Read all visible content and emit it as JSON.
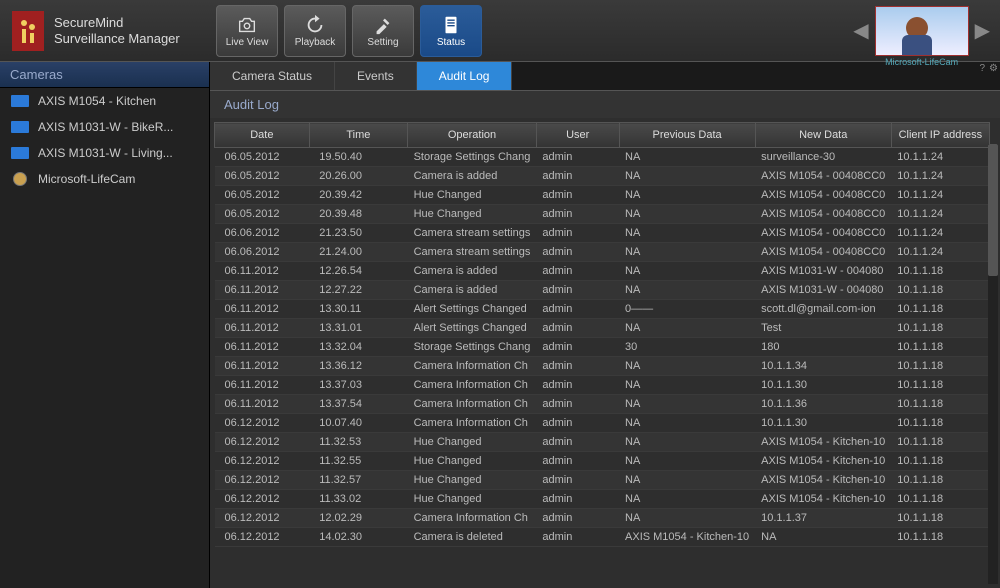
{
  "app": {
    "name": "SecureMind",
    "subtitle": "Surveillance Manager"
  },
  "toolbar": [
    {
      "id": "live-view",
      "label": "Live View",
      "icon": "camera",
      "active": false
    },
    {
      "id": "playback",
      "label": "Playback",
      "icon": "refresh",
      "active": false
    },
    {
      "id": "setting",
      "label": "Setting",
      "icon": "tools",
      "active": false
    },
    {
      "id": "status",
      "label": "Status",
      "icon": "document",
      "active": true
    }
  ],
  "preview": {
    "label": "Microsoft-LifeCam"
  },
  "sidebar": {
    "header": "Cameras",
    "items": [
      {
        "label": "AXIS M1054 - Kitchen",
        "icon": "cam"
      },
      {
        "label": "AXIS M1031-W - BikeR...",
        "icon": "cam"
      },
      {
        "label": "AXIS M1031-W - Living...",
        "icon": "cam"
      },
      {
        "label": "Microsoft-LifeCam",
        "icon": "webcam"
      }
    ]
  },
  "tabs": [
    {
      "label": "Camera Status",
      "active": false
    },
    {
      "label": "Events",
      "active": false
    },
    {
      "label": "Audit Log",
      "active": true
    }
  ],
  "section_title": "Audit Log",
  "columns": [
    "Date",
    "Time",
    "Operation",
    "User",
    "Previous Data",
    "New Data",
    "Client IP address"
  ],
  "rows": [
    [
      "06.05.2012",
      "19.50.40",
      "Storage Settings Chang",
      "admin",
      "NA",
      "surveillance-30",
      "10.1.1.24"
    ],
    [
      "06.05.2012",
      "20.26.00",
      "Camera is added",
      "admin",
      "NA",
      "AXIS M1054 - 00408CC0",
      "10.1.1.24"
    ],
    [
      "06.05.2012",
      "20.39.42",
      "Hue Changed",
      "admin",
      "NA",
      "AXIS M1054 - 00408CC0",
      "10.1.1.24"
    ],
    [
      "06.05.2012",
      "20.39.48",
      "Hue Changed",
      "admin",
      "NA",
      "AXIS M1054 - 00408CC0",
      "10.1.1.24"
    ],
    [
      "06.06.2012",
      "21.23.50",
      "Camera stream settings",
      "admin",
      "NA",
      "AXIS M1054 - 00408CC0",
      "10.1.1.24"
    ],
    [
      "06.06.2012",
      "21.24.00",
      "Camera stream settings",
      "admin",
      "NA",
      "AXIS M1054 - 00408CC0",
      "10.1.1.24"
    ],
    [
      "06.11.2012",
      "12.26.54",
      "Camera is added",
      "admin",
      "NA",
      "AXIS M1031-W - 004080",
      "10.1.1.18"
    ],
    [
      "06.11.2012",
      "12.27.22",
      "Camera is added",
      "admin",
      "NA",
      "AXIS M1031-W - 004080",
      "10.1.1.18"
    ],
    [
      "06.11.2012",
      "13.30.11",
      "Alert Settings Changed",
      "admin",
      "0——",
      "scott.dl@gmail.com-ion",
      "10.1.1.18"
    ],
    [
      "06.11.2012",
      "13.31.01",
      "Alert Settings Changed",
      "admin",
      "NA",
      "Test",
      "10.1.1.18"
    ],
    [
      "06.11.2012",
      "13.32.04",
      "Storage Settings Chang",
      "admin",
      "30",
      "180",
      "10.1.1.18"
    ],
    [
      "06.11.2012",
      "13.36.12",
      "Camera Information Ch",
      "admin",
      "NA",
      "10.1.1.34",
      "10.1.1.18"
    ],
    [
      "06.11.2012",
      "13.37.03",
      "Camera Information Ch",
      "admin",
      "NA",
      "10.1.1.30",
      "10.1.1.18"
    ],
    [
      "06.11.2012",
      "13.37.54",
      "Camera Information Ch",
      "admin",
      "NA",
      "10.1.1.36",
      "10.1.1.18"
    ],
    [
      "06.12.2012",
      "10.07.40",
      "Camera Information Ch",
      "admin",
      "NA",
      "10.1.1.30",
      "10.1.1.18"
    ],
    [
      "06.12.2012",
      "11.32.53",
      "Hue Changed",
      "admin",
      "NA",
      "AXIS M1054 - Kitchen-10",
      "10.1.1.18"
    ],
    [
      "06.12.2012",
      "11.32.55",
      "Hue Changed",
      "admin",
      "NA",
      "AXIS M1054 - Kitchen-10",
      "10.1.1.18"
    ],
    [
      "06.12.2012",
      "11.32.57",
      "Hue Changed",
      "admin",
      "NA",
      "AXIS M1054 - Kitchen-10",
      "10.1.1.18"
    ],
    [
      "06.12.2012",
      "11.33.02",
      "Hue Changed",
      "admin",
      "NA",
      "AXIS M1054 - Kitchen-10",
      "10.1.1.18"
    ],
    [
      "06.12.2012",
      "12.02.29",
      "Camera Information Ch",
      "admin",
      "NA",
      "10.1.1.37",
      "10.1.1.18"
    ],
    [
      "06.12.2012",
      "14.02.30",
      "Camera is deleted",
      "admin",
      "AXIS M1054 - Kitchen-10",
      "NA",
      "10.1.1.18"
    ]
  ],
  "col_widths": [
    "13%",
    "14%",
    "16%",
    "12%",
    "15%",
    "16%",
    "14%"
  ]
}
